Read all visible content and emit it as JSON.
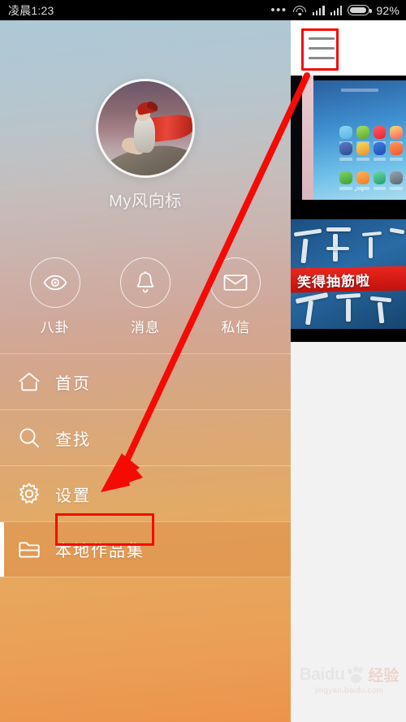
{
  "status_bar": {
    "time": "凌晨1:23",
    "dots": "•••",
    "wifi_icon": "wifi-icon",
    "signal_icon_1": "signal-bars-icon",
    "signal_icon_2": "signal-bars-icon",
    "battery_icon": "battery-icon",
    "battery_percent": "92%",
    "battery_level": 92
  },
  "drawer": {
    "profile": {
      "avatar_alt": "user-avatar-red-cape-figure",
      "username": "My风向标"
    },
    "quick_actions": [
      {
        "icon": "eye-icon",
        "label": "八卦"
      },
      {
        "icon": "bell-icon",
        "label": "消息"
      },
      {
        "icon": "envelope-icon",
        "label": "私信"
      }
    ],
    "menu_items": [
      {
        "icon": "home-icon",
        "label": "首页",
        "active": false
      },
      {
        "icon": "search-icon",
        "label": "查找",
        "active": false
      },
      {
        "icon": "gear-icon",
        "label": "设置",
        "active": false
      },
      {
        "icon": "folder-icon",
        "label": "本地作品集",
        "active": true
      }
    ]
  },
  "main_pane": {
    "header": {
      "menu_icon": "hamburger-menu-icon"
    },
    "thumbnails": [
      {
        "name": "phone-home-screen-screenshot",
        "caption": ""
      },
      {
        "name": "video-thumbnail-calligraphy",
        "caption": "笑得抽筋啦"
      }
    ],
    "watermark": {
      "brand": "Baidu",
      "brand_cn": "经验",
      "paw_icon": "baidu-paw-icon",
      "url": "jingyan.baidu.com"
    }
  },
  "annotations": {
    "highlight_menu_icon": "red-box-around-hamburger-menu",
    "highlight_menu_item": "red-box-around-本地作品集",
    "arrow": "red-arrow-from-menu-icon-to-本地作品集"
  },
  "colors": {
    "annotation_red": "#f60a06",
    "status_bar_bg": "#000000",
    "drawer_top": "#adc8d6",
    "drawer_bottom": "#ed934c",
    "main_bg": "#f2f2f3",
    "header_bg": "#ffffff"
  }
}
